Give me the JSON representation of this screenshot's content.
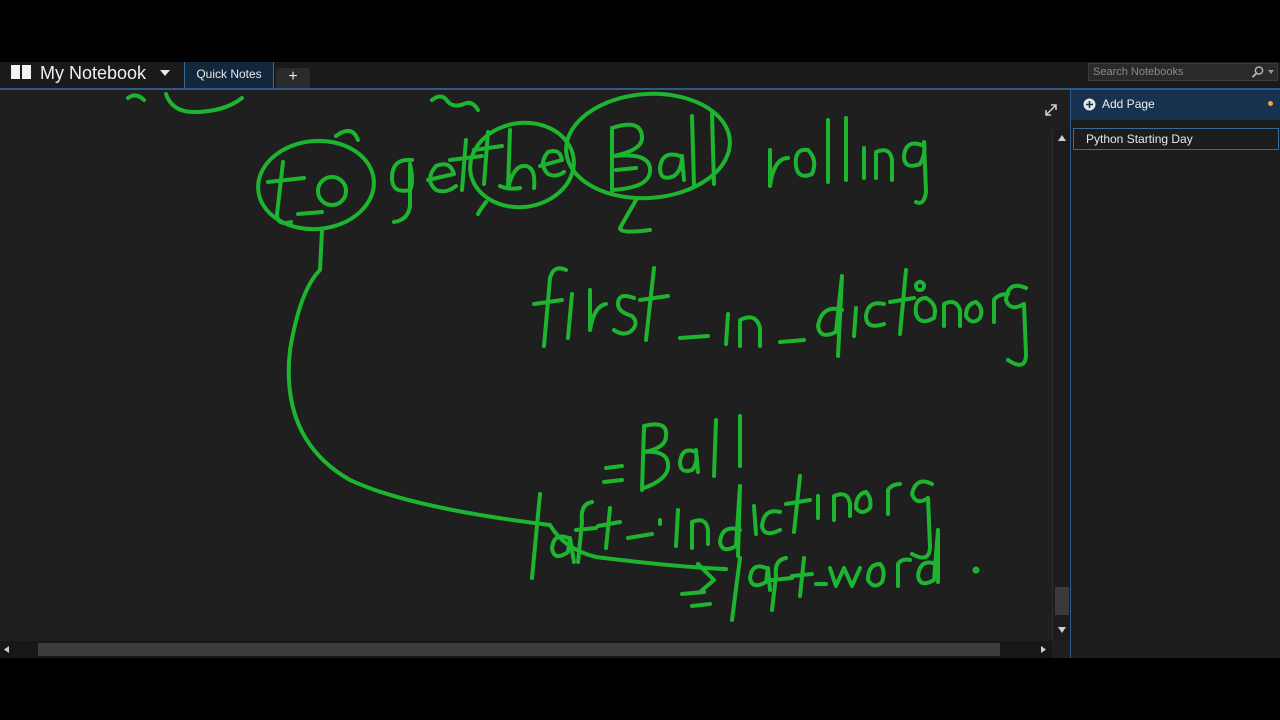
{
  "header": {
    "notebook_title": "My Notebook",
    "tabs": [
      {
        "label": "Quick Notes",
        "selected": true
      }
    ],
    "add_tab_label": "+",
    "search": {
      "placeholder": "Search Notebooks",
      "value": ""
    }
  },
  "right_panel": {
    "add_page_label": "Add Page",
    "pages": [
      {
        "title": "Python Starting Day",
        "selected": true
      }
    ]
  },
  "colors": {
    "ink": "#1db52f",
    "accent": "#2d5a86",
    "tab_bg": "#13273c",
    "add_page_bg": "#16324f",
    "dot": "#e8a33b"
  },
  "icons": [
    "notebook-icon",
    "chevron-down-icon",
    "search-icon",
    "expand-icon",
    "add-icon",
    "arrow-up-icon",
    "arrow-down-icon",
    "arrow-left-icon",
    "arrow-right-icon"
  ]
}
